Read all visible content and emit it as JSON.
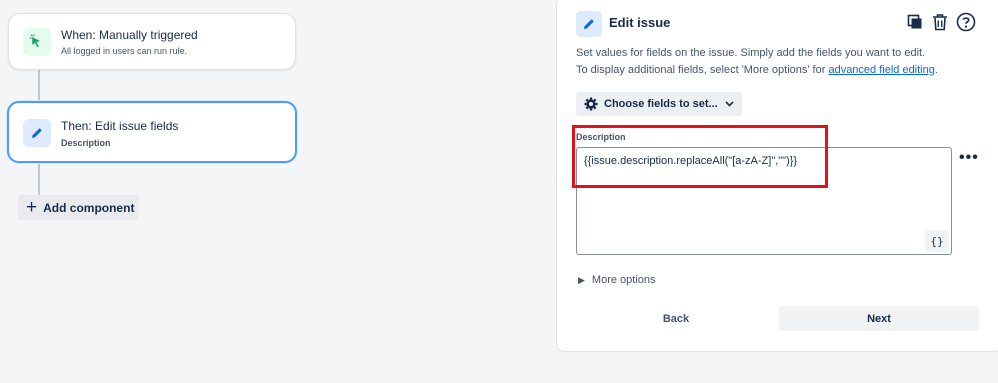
{
  "canvas": {
    "trigger": {
      "title": "When: Manually triggered",
      "subtitle": "All logged in users can run rule.",
      "icon": "cursor-click-icon"
    },
    "action": {
      "title": "Then: Edit issue fields",
      "subtitle": "Description",
      "icon": "pencil-icon"
    },
    "add_component_label": "Add component"
  },
  "panel": {
    "title": "Edit issue",
    "icon": "pencil-icon",
    "header_actions": [
      "copy-icon",
      "trash-icon",
      "help-icon"
    ],
    "description_line1": "Set values for fields on the issue. Simply add the fields you want to edit.",
    "description_line2_prefix": "To display additional fields, select 'More options' for ",
    "description_link": "advanced field editing",
    "description_line2_suffix": ".",
    "choose_fields_label": "Choose fields to set...",
    "field": {
      "label": "Description",
      "value": "{{issue.description.replaceAll(\"[a-zA-Z]\",\"\")}}",
      "smart_value_button": "{}"
    },
    "more_options_label": "More options",
    "back_label": "Back",
    "next_label": "Next"
  },
  "colors": {
    "accent": "#0c66e4",
    "selected_border": "#4c9aff",
    "highlight": "#e3121a",
    "trigger_icon": "#22a06b"
  }
}
